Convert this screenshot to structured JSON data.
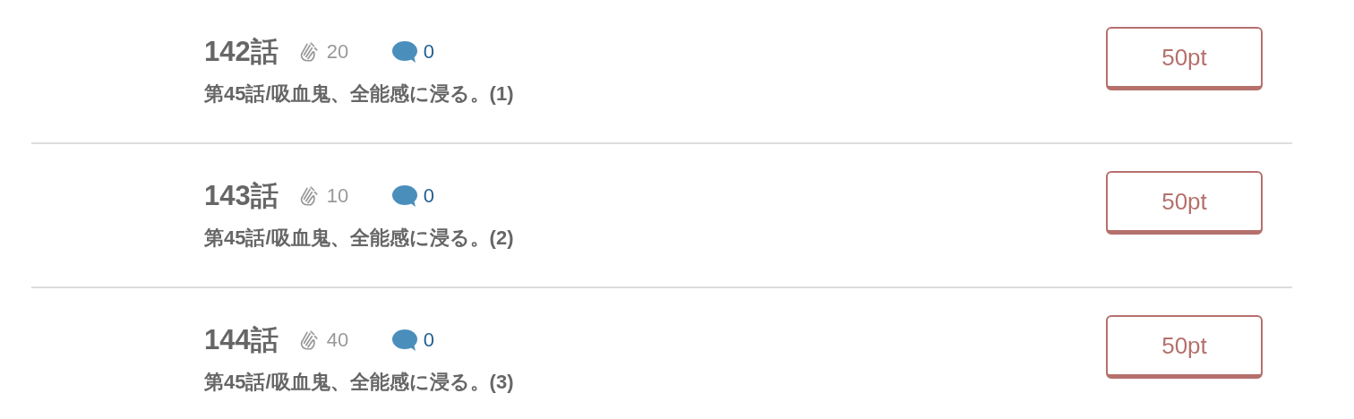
{
  "episodes": [
    {
      "number": "142話",
      "claps": "20",
      "comments": "0",
      "title": "第45話/吸血鬼、全能感に浸る。(1)",
      "price": "50pt"
    },
    {
      "number": "143話",
      "claps": "10",
      "comments": "0",
      "title": "第45話/吸血鬼、全能感に浸る。(2)",
      "price": "50pt"
    },
    {
      "number": "144話",
      "claps": "40",
      "comments": "0",
      "title": "第45話/吸血鬼、全能感に浸る。(3)",
      "price": "50pt"
    }
  ]
}
